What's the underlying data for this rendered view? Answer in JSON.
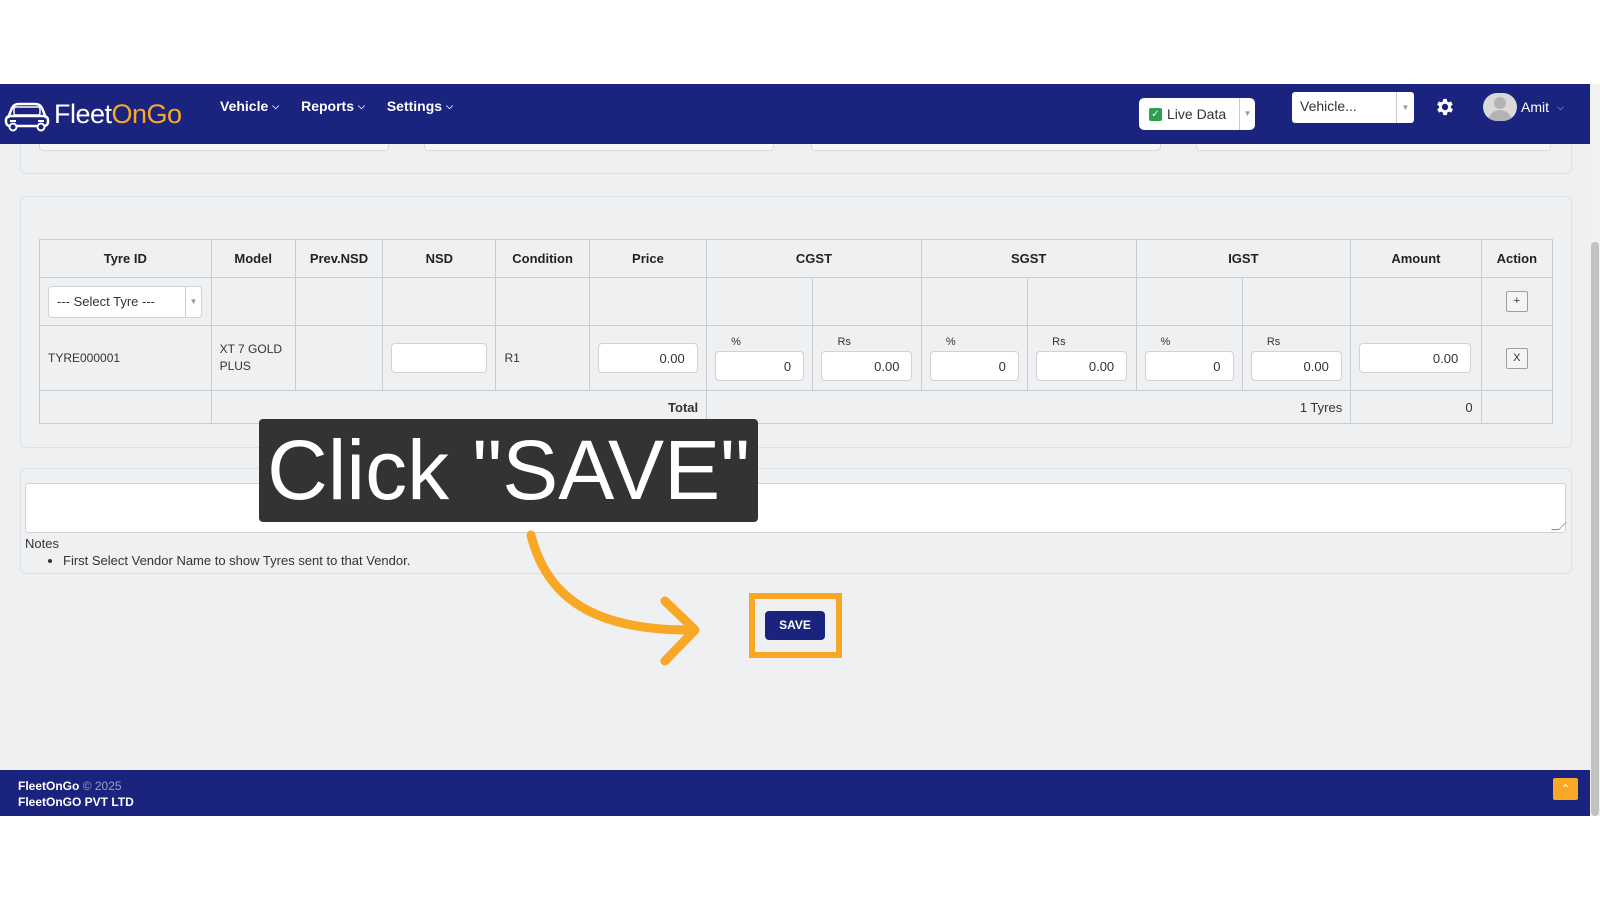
{
  "app": {
    "logo_fleet": "Fleet",
    "logo_on": "OnGo",
    "brand_color": "#1a237e",
    "accent_color": "#f9a825"
  },
  "nav": {
    "items": [
      {
        "label": "Vehicle",
        "icon": "chevron-down-icon"
      },
      {
        "label": "Reports",
        "icon": "chevron-down-icon"
      },
      {
        "label": "Settings",
        "icon": "chevron-down-icon"
      }
    ],
    "live_data_label": "Live Data",
    "live_data_checked": true,
    "vehicle_placeholder": "Vehicle...",
    "settings_icon": "gear-icon",
    "user_name": "Amit"
  },
  "table": {
    "headers": [
      "Tyre ID",
      "Model",
      "Prev.NSD",
      "NSD",
      "Condition",
      "Price",
      "CGST",
      "SGST",
      "IGST",
      "Amount",
      "Action"
    ],
    "select_placeholder": "--- Select Tyre ---",
    "add_button": "+",
    "row": {
      "tyre_id": "TYRE000001",
      "model": "XT 7 GOLD PLUS",
      "prev_nsd": "",
      "nsd": "",
      "condition": "R1",
      "price": "0.00",
      "cgst_pct_label": "%",
      "cgst_pct": "0",
      "cgst_rs_label": "Rs",
      "cgst_rs": "0.00",
      "sgst_pct_label": "%",
      "sgst_pct": "0",
      "sgst_rs_label": "Rs",
      "sgst_rs": "0.00",
      "igst_pct_label": "%",
      "igst_pct": "0",
      "igst_rs_label": "Rs",
      "igst_rs": "0.00",
      "amount": "0.00",
      "remove_button": "X"
    },
    "total": {
      "label": "Total",
      "count": "1 Tyres",
      "amount": "0"
    }
  },
  "notes": {
    "title": "Notes",
    "items": [
      "First Select Vendor Name to show Tyres sent to that Vendor."
    ]
  },
  "save_label": "SAVE",
  "overlay": {
    "callout": "Click \"SAVE\""
  },
  "footer": {
    "brand": "FleetOnGo",
    "copyright": "© 2025",
    "company": "FleetOnGO PVT LTD",
    "scroll_top_icon": "chevron-up-icon"
  }
}
